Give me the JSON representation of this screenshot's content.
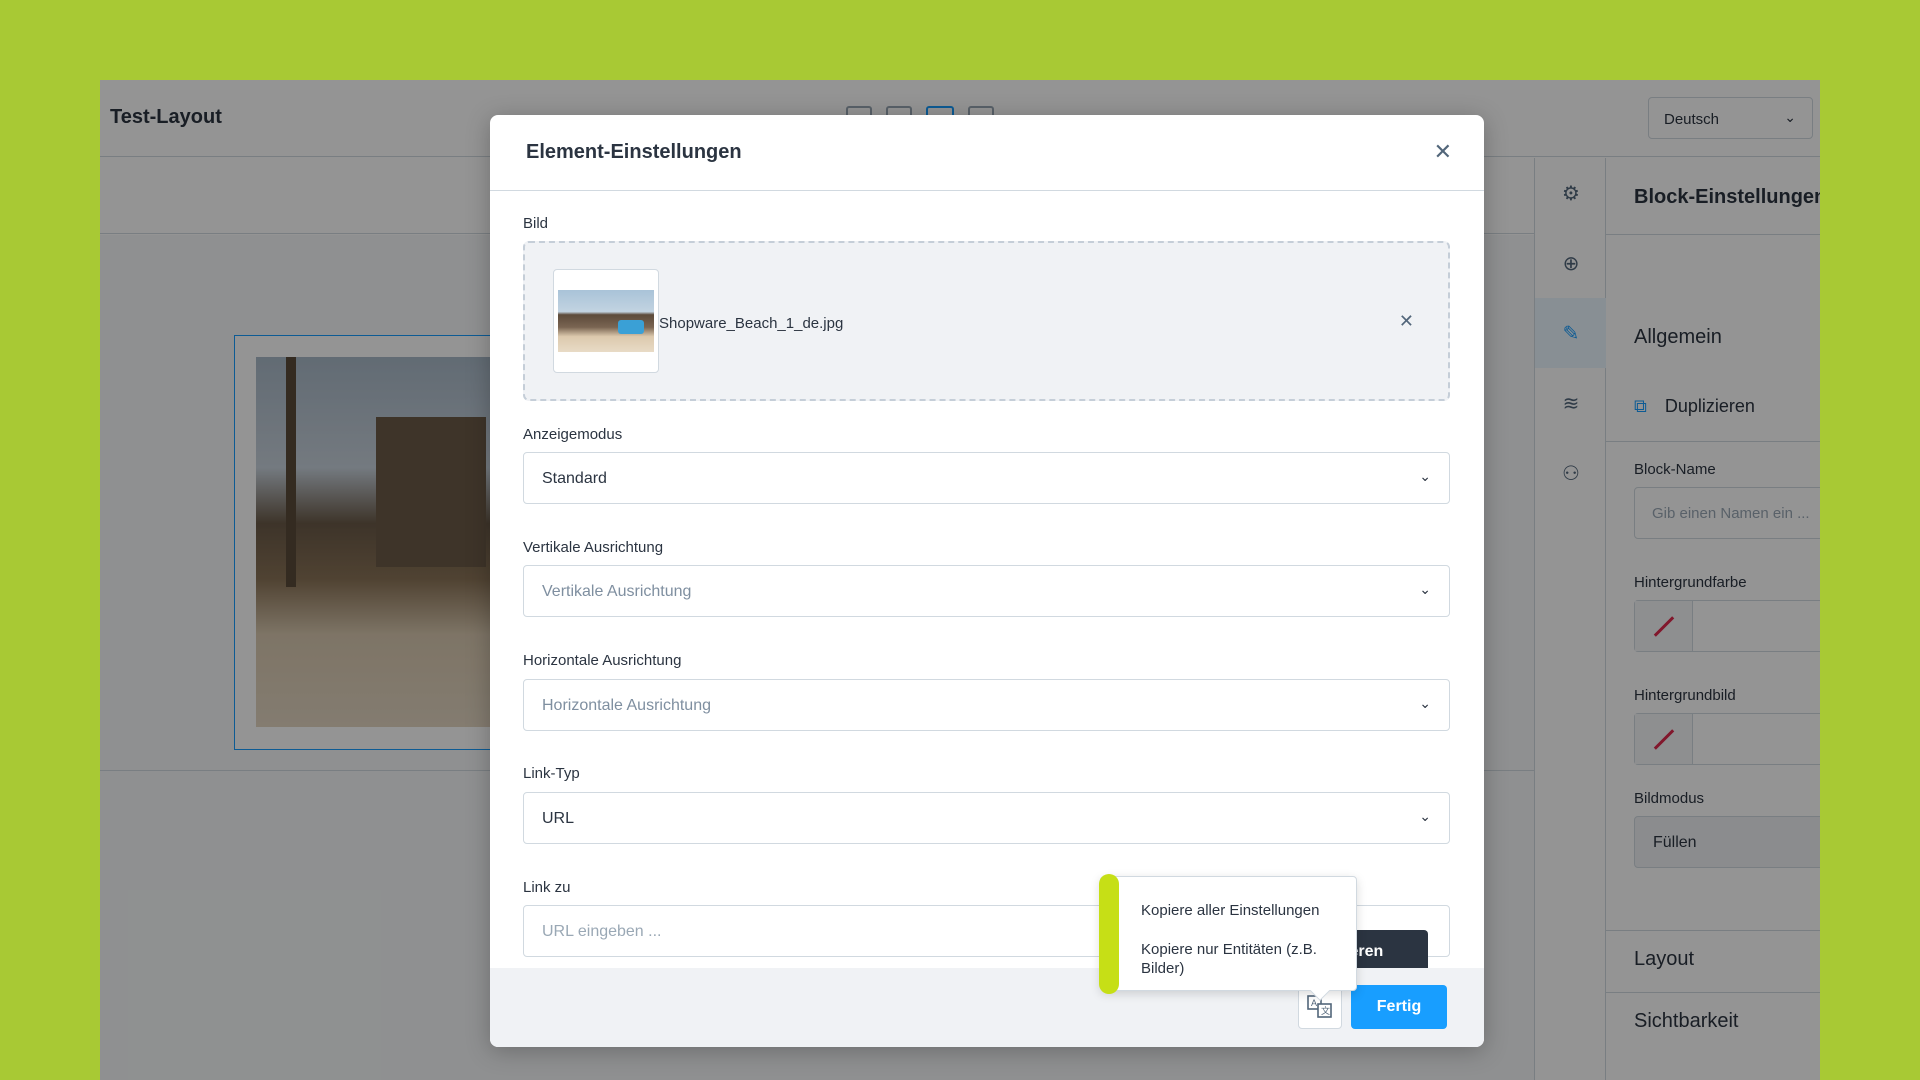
{
  "app": {
    "title": "Test-Layout",
    "language": "Deutsch"
  },
  "sidebar_icons": [
    "gear-icon",
    "plus-circle-icon",
    "edit-icon",
    "layers-icon",
    "share-icon"
  ],
  "settings_panel": {
    "title": "Block-Einstellungen",
    "general_section": "Allgemein",
    "duplicate_label": "Duplizieren",
    "block_name_label": "Block-Name",
    "block_name_placeholder": "Gib einen Namen ein ...",
    "bg_color_label": "Hintergrundfarbe",
    "bg_image_label": "Hintergrundbild",
    "image_mode_label": "Bildmodus",
    "image_mode_value": "Füllen",
    "layout_section": "Layout",
    "visibility_section": "Sichtbarkeit"
  },
  "modal": {
    "title": "Element-Einstellungen",
    "image_label": "Bild",
    "file_name": "Shopware_Beach_1_de.jpg",
    "display_mode_label": "Anzeigemodus",
    "display_mode_value": "Standard",
    "vertical_align_label": "Vertikale Ausrichtung",
    "vertical_align_placeholder": "Vertikale Ausrichtung",
    "horizontal_align_label": "Horizontale Ausrichtung",
    "horizontal_align_placeholder": "Horizontale Ausrichtung",
    "link_type_label": "Link-Typ",
    "link_type_value": "URL",
    "link_to_label": "Link zu",
    "link_to_placeholder": "URL eingeben ...",
    "dark_button_label": "ieren",
    "done_button": "Fertig"
  },
  "popover": {
    "item_all": "Kopiere aller Einstellungen",
    "item_entities": "Kopiere nur Entitäten (z.B. Bilder)"
  },
  "colors": {
    "background": "#a8c934",
    "primary": "#189eff",
    "accent": "#c6df16",
    "dark": "#2b3441"
  }
}
